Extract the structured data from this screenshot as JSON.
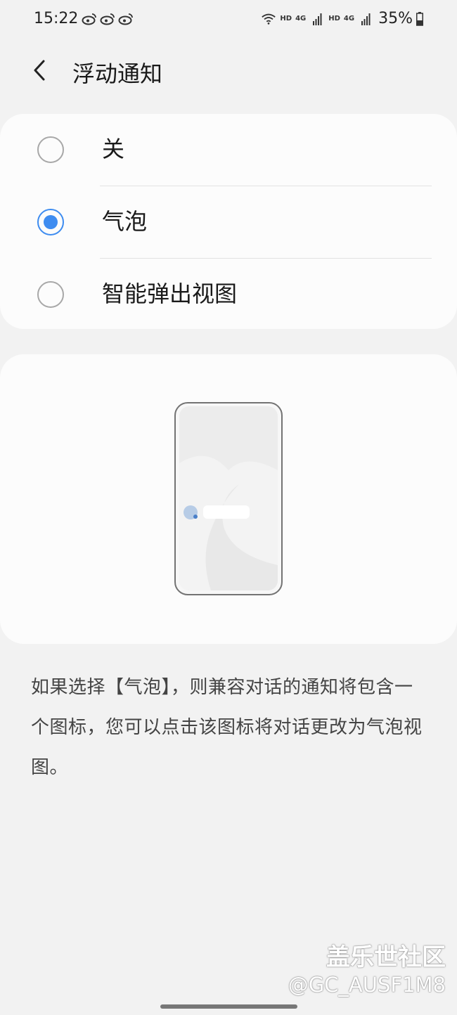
{
  "status_bar": {
    "time": "15:22",
    "notification_icons": [
      "weibo-icon",
      "weibo-icon",
      "weibo-icon"
    ],
    "hd1": "HD",
    "hd2": "HD",
    "network1": "4G",
    "network2": "4G",
    "battery": "35%"
  },
  "app_bar": {
    "title": "浮动通知"
  },
  "options": [
    {
      "label": "关",
      "checked": false
    },
    {
      "label": "气泡",
      "checked": true
    },
    {
      "label": "智能弹出视图",
      "checked": false
    }
  ],
  "description": "如果选择【气泡】，则兼容对话的通知将包含一个图标，您可以点击该图标将对话更改为气泡视图。",
  "watermark": {
    "line1": "盖乐世社区",
    "line2": "@GC_AUSF1M8"
  },
  "colors": {
    "accent": "#3e8cf0",
    "background": "#f2f2f2",
    "card": "#fcfcfc"
  }
}
